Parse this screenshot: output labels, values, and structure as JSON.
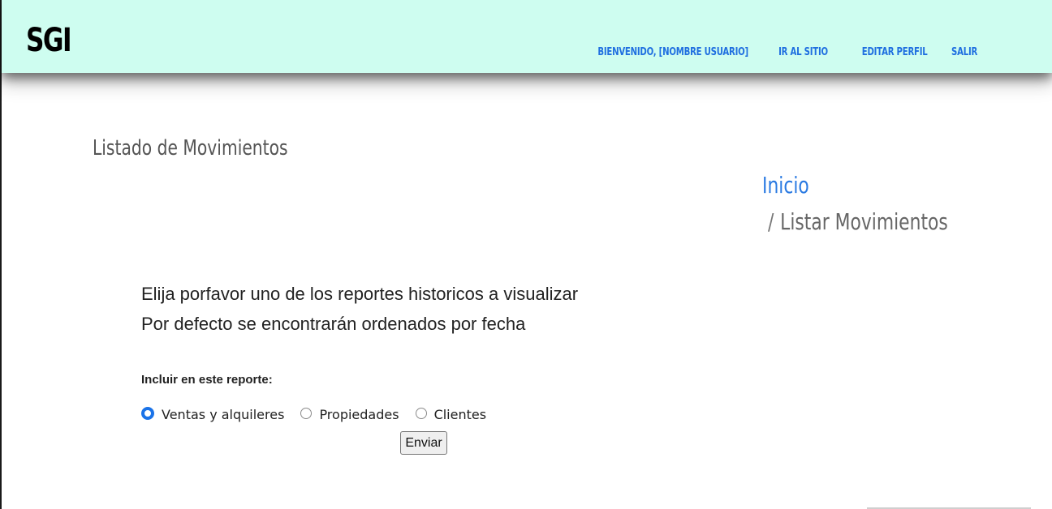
{
  "header": {
    "brand": "SGI",
    "nav": [
      {
        "label": "Bienvenido, [nombre usuario]"
      },
      {
        "label": "Ir al sitio"
      },
      {
        "label": "Editar perfil"
      },
      {
        "label": "Salir"
      }
    ]
  },
  "main": {
    "title": "Listado de Movimientos",
    "breadcrumb": {
      "home": "Inicio",
      "separator": "/",
      "current": "Listar Movimientos"
    },
    "intro": {
      "line1": "Elija porfavor uno de los reportes historicos a visualizar",
      "line2": "Por defecto se encontrarán ordenados por fecha"
    },
    "form": {
      "label": "Incluir en este reporte:",
      "options": [
        {
          "label": "Ventas y alquileres",
          "checked": true
        },
        {
          "label": "Propiedades",
          "checked": false
        },
        {
          "label": "Clientes",
          "checked": false
        }
      ],
      "submit_label": "Enviar"
    }
  },
  "colors": {
    "header_bg": "#cefdf0",
    "nav_link": "#1f6fe0",
    "breadcrumb_link": "#2a7ae2",
    "radio_checked": "#1a73e8"
  }
}
